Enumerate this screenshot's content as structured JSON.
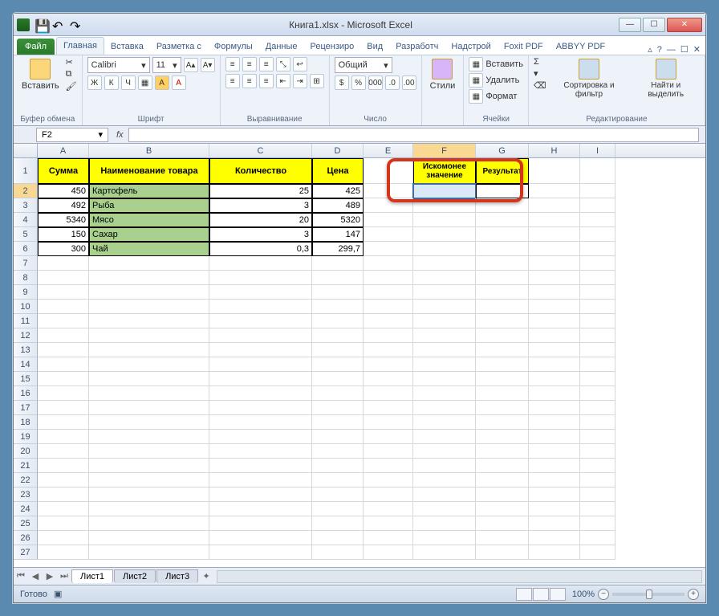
{
  "title": "Книга1.xlsx - Microsoft Excel",
  "qat": {
    "excel": "X",
    "save": "💾",
    "undo": "↶",
    "redo": "↷"
  },
  "winbtns": {
    "min": "—",
    "max": "☐",
    "close": "✕"
  },
  "tabs": {
    "file": "Файл",
    "items": [
      "Главная",
      "Вставка",
      "Разметка с",
      "Формулы",
      "Данные",
      "Рецензиро",
      "Вид",
      "Разработч",
      "Надстрой",
      "Foxit PDF",
      "ABBYY PDF"
    ],
    "active": 0,
    "help": "?"
  },
  "ribbon": {
    "clipboard": {
      "label": "Буфер обмена",
      "paste": "Вставить"
    },
    "font": {
      "label": "Шрифт",
      "name": "Calibri",
      "size": "11",
      "bold": "Ж",
      "italic": "К",
      "underline": "Ч"
    },
    "align": {
      "label": "Выравнивание"
    },
    "number": {
      "label": "Число",
      "format": "Общий",
      "currency": "$",
      "percent": "%"
    },
    "styles": {
      "label": "",
      "btn": "Стили"
    },
    "cells": {
      "label": "Ячейки",
      "insert": "Вставить",
      "delete": "Удалить",
      "format": "Формат"
    },
    "editing": {
      "label": "Редактирование",
      "sort": "Сортировка и фильтр",
      "find": "Найти и выделить"
    }
  },
  "namebox": "F2",
  "fx": "fx",
  "formula": "",
  "columns": [
    "A",
    "B",
    "C",
    "D",
    "E",
    "F",
    "G",
    "H",
    "I"
  ],
  "headers": {
    "A": "Сумма",
    "B": "Наименование товара",
    "C": "Количество",
    "D": "Цена",
    "F": "Искомонее значение",
    "G": "Результат"
  },
  "data": [
    {
      "r": 2,
      "A": "450",
      "B": "Картофель",
      "C": "25",
      "D": "425"
    },
    {
      "r": 3,
      "A": "492",
      "B": "Рыба",
      "C": "3",
      "D": "489"
    },
    {
      "r": 4,
      "A": "5340",
      "B": "Мясо",
      "C": "20",
      "D": "5320"
    },
    {
      "r": 5,
      "A": "150",
      "B": "Сахар",
      "C": "3",
      "D": "147"
    },
    {
      "r": 6,
      "A": "300",
      "B": "Чай",
      "C": "0,3",
      "D": "299,7"
    }
  ],
  "selected_cell": "F2",
  "sheets": {
    "active": "Лист1",
    "others": [
      "Лист2",
      "Лист3"
    ]
  },
  "status": "Готово",
  "zoom": "100%"
}
